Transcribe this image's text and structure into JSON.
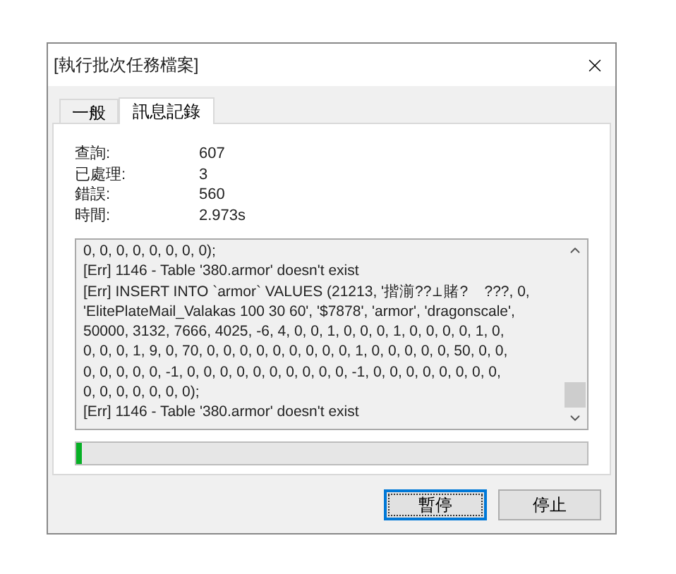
{
  "window": {
    "title": "[執行批次任務檔案]"
  },
  "tabs": [
    {
      "label": "一般",
      "selected": false
    },
    {
      "label": "訊息記錄",
      "selected": true
    }
  ],
  "stats": [
    {
      "label": "查詢:",
      "value": "607"
    },
    {
      "label": "已處理:",
      "value": "3"
    },
    {
      "label": "錯誤:",
      "value": "560"
    },
    {
      "label": "時間:",
      "value": "2.973s"
    }
  ],
  "log": {
    "lines": [
      "0, 0, 0, 0, 0, 0, 0, 0);",
      "[Err] 1146 - Table '380.armor' doesn't exist",
      "[Err] INSERT INTO `armor` VALUES (21213, '揩湔??⊥賭?    ???, 0,",
      "'ElitePlateMail_Valakas 100 30 60', '$7878', 'armor', 'dragonscale',",
      "50000, 3132, 7666, 4025, -6, 4, 0, 0, 1, 0, 0, 0, 1, 0, 0, 0, 0, 1, 0,",
      "0, 0, 0, 1, 9, 0, 70, 0, 0, 0, 0, 0, 0, 0, 0, 0, 1, 0, 0, 0, 0, 0, 50, 0, 0,",
      "0, 0, 0, 0, 0, -1, 0, 0, 0, 0, 0, 0, 0, 0, 0, 0, -1, 0, 0, 0, 0, 0, 0, 0, 0,",
      "0, 0, 0, 0, 0, 0, 0);",
      "[Err] 1146 - Table '380.armor' doesn't exist"
    ]
  },
  "progress": {
    "level": 0.01
  },
  "buttons": [
    {
      "label": "暫停",
      "focused": true
    },
    {
      "label": "停止",
      "focused": false
    }
  ]
}
